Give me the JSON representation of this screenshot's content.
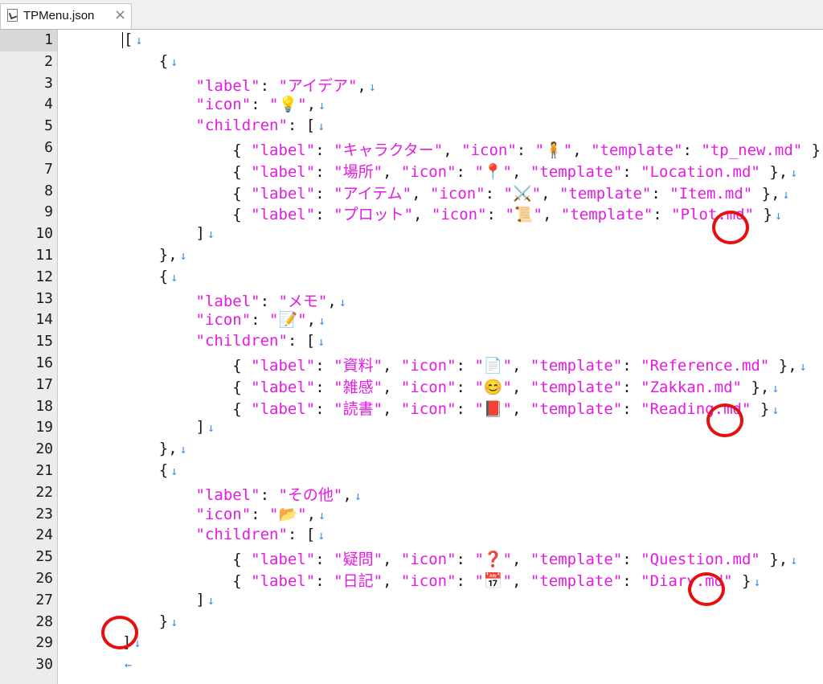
{
  "tab": {
    "title": "TPMenu.json",
    "close": "×"
  },
  "lines": [
    {
      "n": "1",
      "t": "["
    },
    {
      "n": "2",
      "t": "    {"
    },
    {
      "n": "3",
      "t": "        \"label\": \"アイデア\","
    },
    {
      "n": "4",
      "t": "        \"icon\": \"💡\","
    },
    {
      "n": "5",
      "t": "        \"children\": ["
    },
    {
      "n": "6",
      "t": "            { \"label\": \"キャラクター\", \"icon\": \"🧍\", \"template\": \"tp_new.md\" },"
    },
    {
      "n": "7",
      "t": "            { \"label\": \"場所\", \"icon\": \"📍\", \"template\": \"Location.md\" },"
    },
    {
      "n": "8",
      "t": "            { \"label\": \"アイテム\", \"icon\": \"⚔️\", \"template\": \"Item.md\" },"
    },
    {
      "n": "9",
      "t": "            { \"label\": \"プロット\", \"icon\": \"📜\", \"template\": \"Plot.md\" }"
    },
    {
      "n": "10",
      "t": "        ]"
    },
    {
      "n": "11",
      "t": "    },"
    },
    {
      "n": "12",
      "t": "    {"
    },
    {
      "n": "13",
      "t": "        \"label\": \"メモ\","
    },
    {
      "n": "14",
      "t": "        \"icon\": \"📝\","
    },
    {
      "n": "15",
      "t": "        \"children\": ["
    },
    {
      "n": "16",
      "t": "            { \"label\": \"資料\", \"icon\": \"📄\", \"template\": \"Reference.md\" },"
    },
    {
      "n": "17",
      "t": "            { \"label\": \"雑感\", \"icon\": \"😊\", \"template\": \"Zakkan.md\" },"
    },
    {
      "n": "18",
      "t": "            { \"label\": \"読書\", \"icon\": \"📕\", \"template\": \"Reading.md\" }"
    },
    {
      "n": "19",
      "t": "        ]"
    },
    {
      "n": "20",
      "t": "    },"
    },
    {
      "n": "21",
      "t": "    {"
    },
    {
      "n": "22",
      "t": "        \"label\": \"その他\","
    },
    {
      "n": "23",
      "t": "        \"icon\": \"📂\","
    },
    {
      "n": "24",
      "t": "        \"children\": ["
    },
    {
      "n": "25",
      "t": "            { \"label\": \"疑問\", \"icon\": \"❓\", \"template\": \"Question.md\" },"
    },
    {
      "n": "26",
      "t": "            { \"label\": \"日記\", \"icon\": \"📅\", \"template\": \"Diary.md\" }"
    },
    {
      "n": "27",
      "t": "        ]"
    },
    {
      "n": "28",
      "t": "    }"
    },
    {
      "n": "29",
      "t": "]"
    },
    {
      "n": "30",
      "t": ""
    }
  ],
  "line_end_marks": {
    "newline": "↓",
    "eof": "←"
  },
  "colors": {
    "string": "#e51ae5",
    "newline_mark": "#3d8ff0",
    "annotation_circle": "#e51010"
  }
}
